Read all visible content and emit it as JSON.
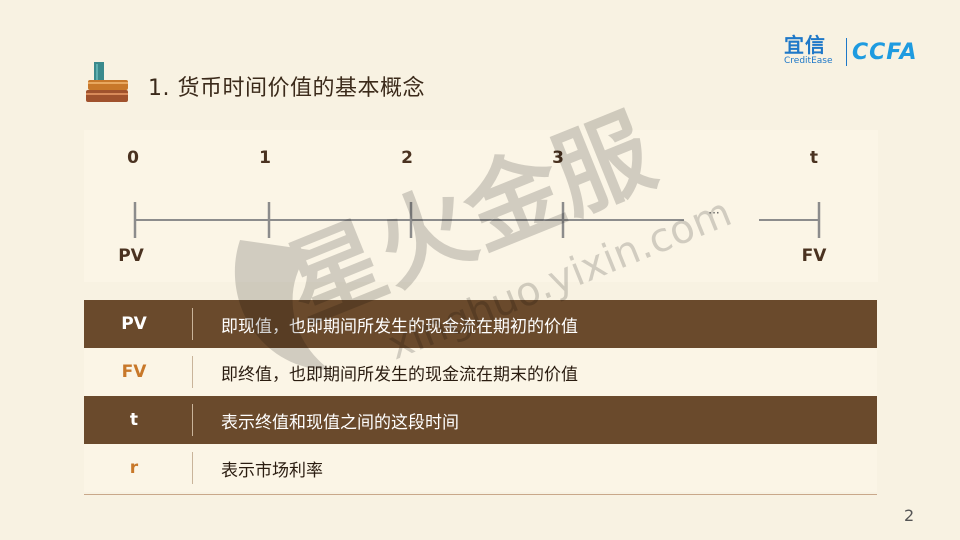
{
  "header": {
    "title": "1. 货币时间价值的基本概念",
    "logo_yixin_cn": "宜信",
    "logo_yixin_en": "CreditEase",
    "logo_ccfa": "CCFA"
  },
  "timeline": {
    "ticks": [
      "0",
      "1",
      "2",
      "3",
      "t"
    ],
    "ellipsis": "···",
    "start_label": "PV",
    "end_label": "FV"
  },
  "definitions": [
    {
      "key": "PV",
      "desc": "即现值，也即期间所发生的现金流在期初的价值"
    },
    {
      "key": "FV",
      "desc": "即终值，也即期间所发生的现金流在期末的价值"
    },
    {
      "key": "t",
      "desc": "表示终值和现值之间的这段时间"
    },
    {
      "key": "r",
      "desc": "表示市场利率"
    }
  ],
  "watermark": {
    "text_cn": "星火金服",
    "text_url": "xinghuo.yixin.com"
  },
  "page_number": "2",
  "colors": {
    "background": "#f8f2e2",
    "dark_row": "#6a4a2c",
    "accent_orange": "#c8782a",
    "brand_blue": "#1e78c8"
  }
}
